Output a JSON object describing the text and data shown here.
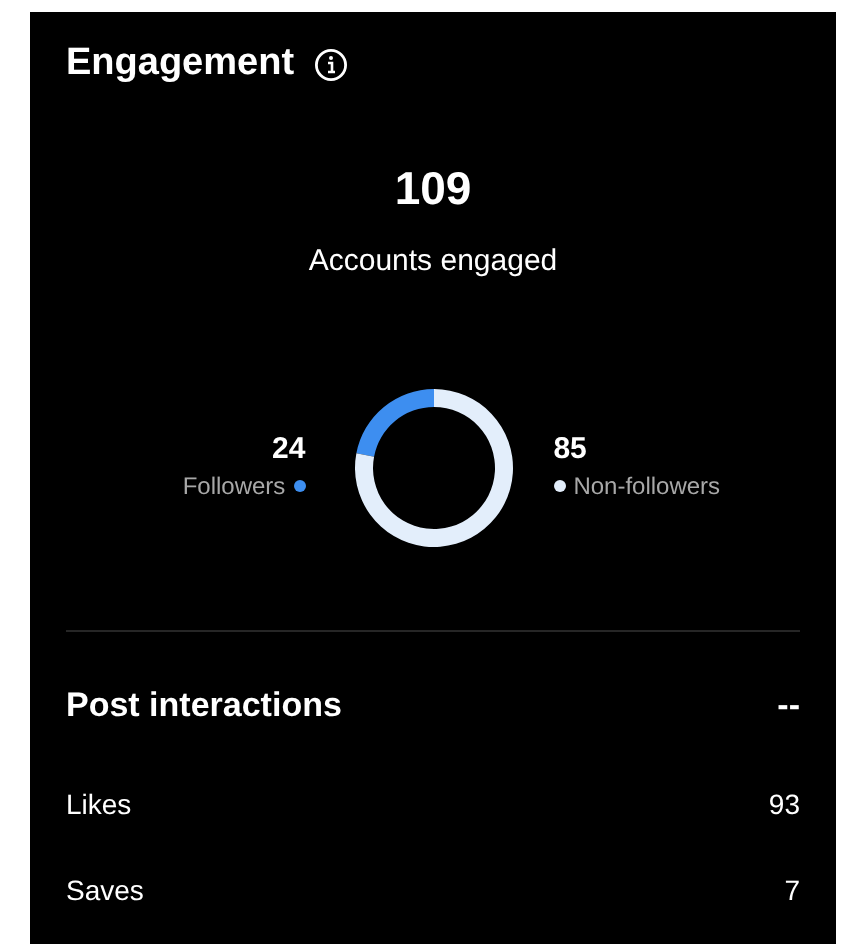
{
  "title": "Engagement",
  "total": {
    "value": "109",
    "label": "Accounts engaged"
  },
  "legend": [
    {
      "value": "24",
      "label": "Followers",
      "color": "#3d8ef0"
    },
    {
      "value": "85",
      "label": "Non-followers",
      "color": "#e3eefb"
    }
  ],
  "post_interactions": {
    "title": "Post interactions",
    "value": "--",
    "rows": [
      {
        "label": "Likes",
        "value": "93"
      },
      {
        "label": "Saves",
        "value": "7"
      }
    ]
  }
}
